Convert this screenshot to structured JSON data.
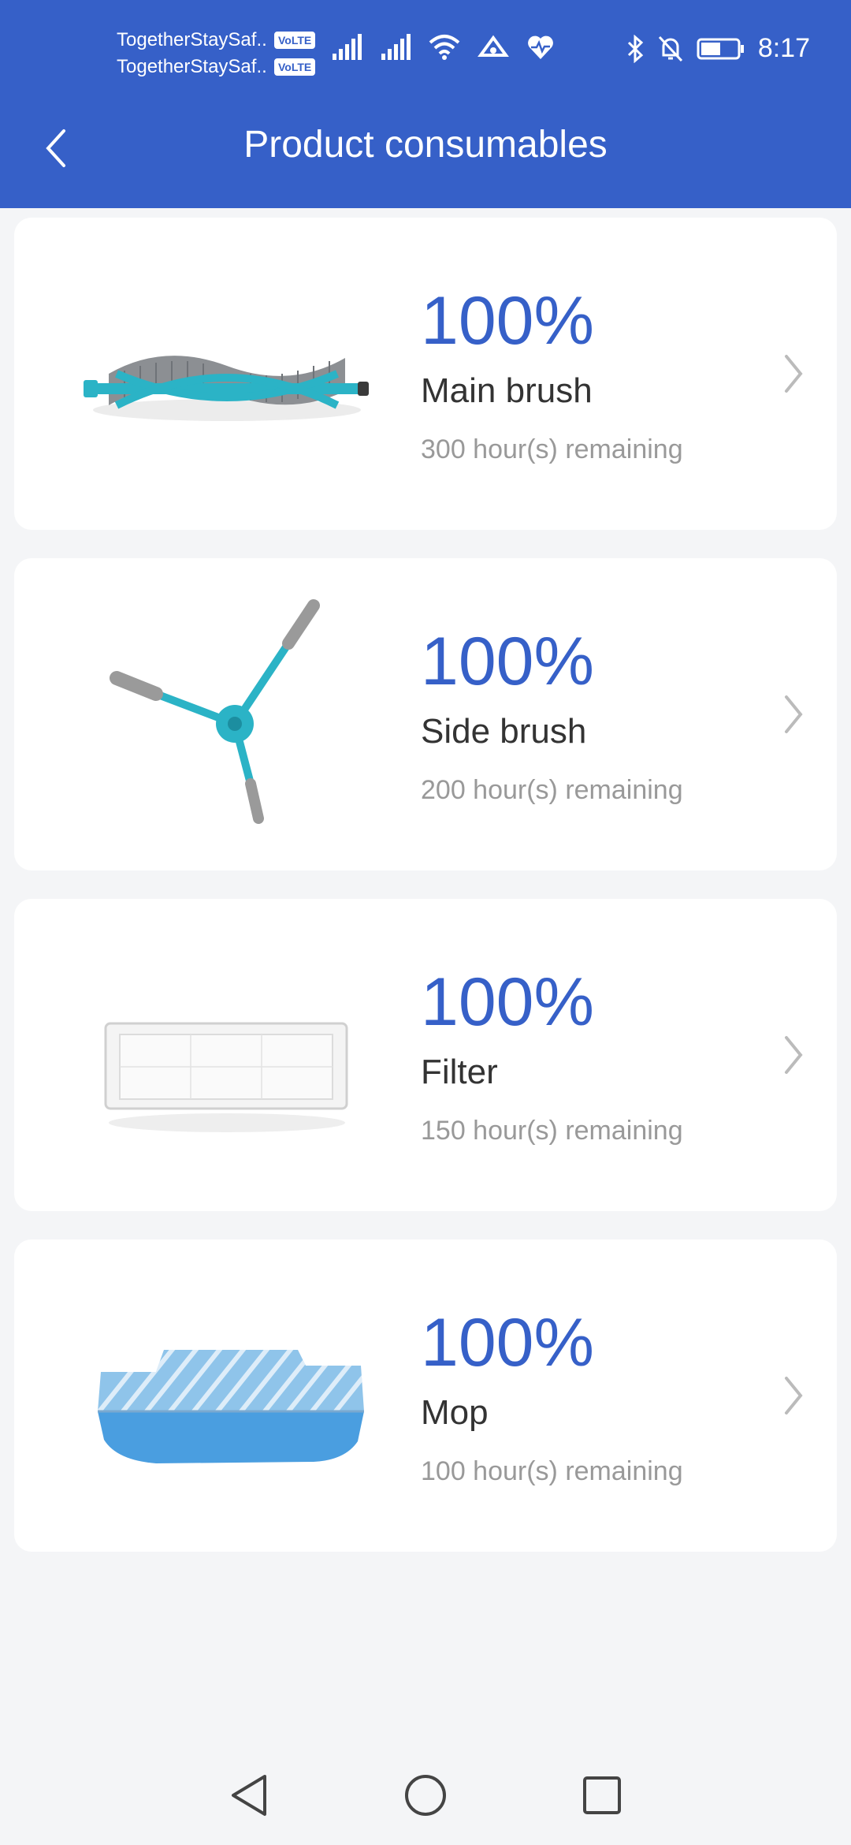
{
  "status_bar": {
    "carrier1": "TogetherStaySaf...",
    "carrier2": "TogetherStaySaf...",
    "volte": "VoLTE",
    "time": "8:17"
  },
  "header": {
    "title": "Product consumables",
    "back_icon": "back-chevron-icon"
  },
  "consumables": [
    {
      "percent": "100%",
      "name": "Main brush",
      "remaining": "300 hour(s) remaining",
      "icon": "main-brush-image"
    },
    {
      "percent": "100%",
      "name": "Side brush",
      "remaining": "200 hour(s) remaining",
      "icon": "side-brush-image"
    },
    {
      "percent": "100%",
      "name": "Filter",
      "remaining": "150 hour(s) remaining",
      "icon": "filter-image"
    },
    {
      "percent": "100%",
      "name": "Mop",
      "remaining": "100 hour(s) remaining",
      "icon": "mop-image"
    }
  ],
  "nav": {
    "back": "nav-back-icon",
    "home": "nav-home-icon",
    "recents": "nav-recents-icon"
  },
  "colors": {
    "accent": "#3660c8",
    "background": "#f4f5f7",
    "card": "#ffffff",
    "teal": "#2bb3c6"
  }
}
